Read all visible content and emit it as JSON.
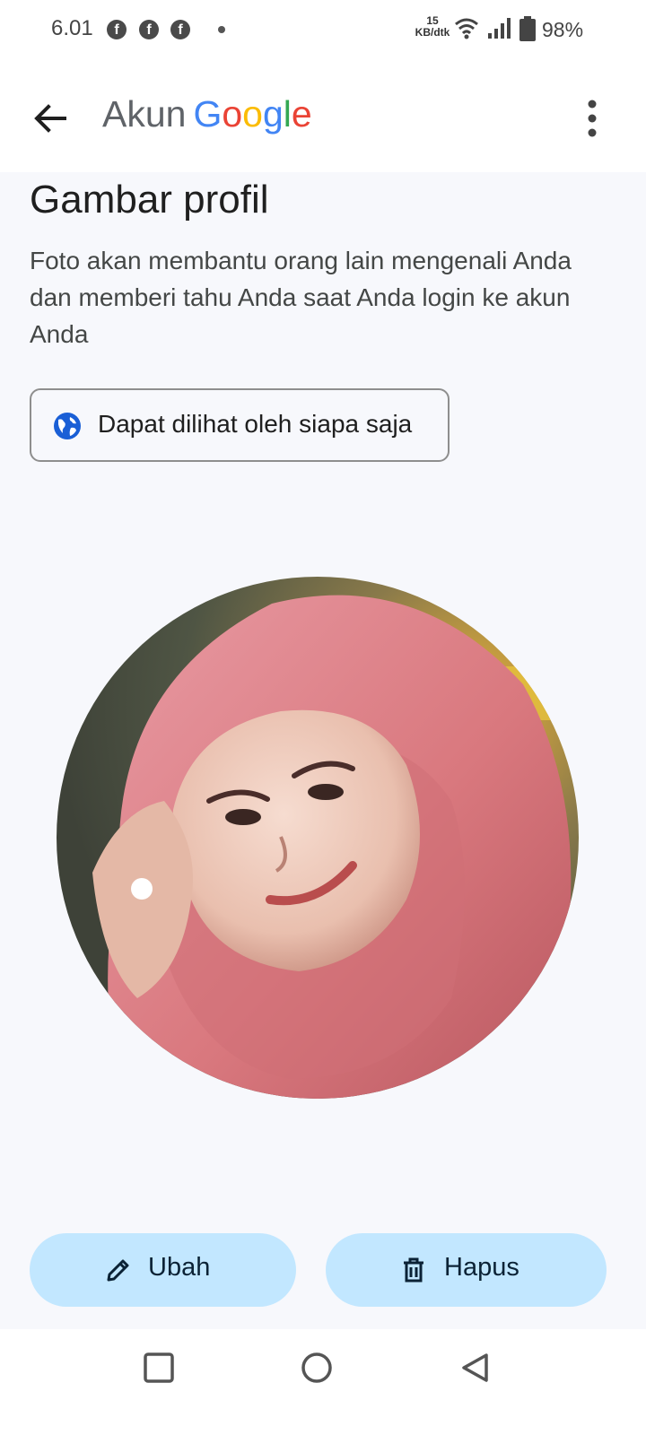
{
  "status_bar": {
    "time": "6.01",
    "notifications": [
      "facebook-icon",
      "facebook-icon",
      "facebook-icon"
    ],
    "net_speed_value": "15",
    "net_speed_unit": "KB/dtk",
    "battery_percent": "98%"
  },
  "app_bar": {
    "title_prefix": "Akun",
    "brand_letters": [
      "G",
      "o",
      "o",
      "g",
      "l",
      "e"
    ],
    "back_icon": "arrow-back-icon",
    "menu_icon": "more-vert-icon"
  },
  "page": {
    "title": "Gambar profil",
    "description": "Foto akan membantu orang lain mengenali Anda dan memberi tahu Anda saat Anda login ke akun Anda",
    "visibility_label": "Dapat dilihat oleh siapa saja",
    "visibility_icon": "globe-icon"
  },
  "actions": {
    "edit_label": "Ubah",
    "edit_icon": "pencil-icon",
    "delete_label": "Hapus",
    "delete_icon": "trash-icon"
  },
  "colors": {
    "accent_button_bg": "#c2e7ff",
    "google_blue": "#4285F4",
    "google_red": "#EA4335",
    "google_yellow": "#FBBC05",
    "google_green": "#34A853"
  }
}
